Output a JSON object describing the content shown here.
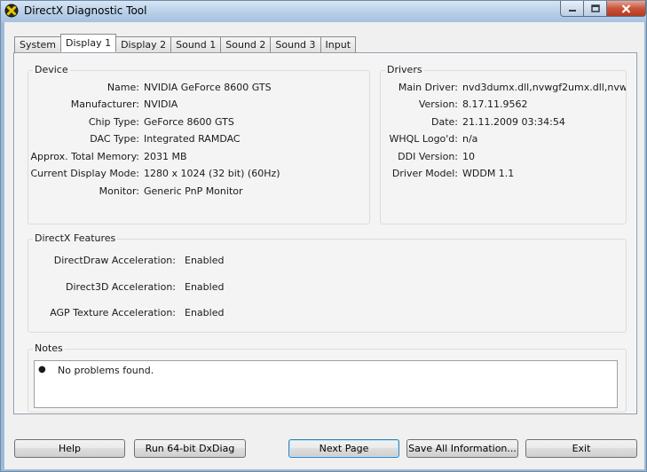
{
  "window": {
    "title": "DirectX Diagnostic Tool"
  },
  "tabs": [
    {
      "label": "System"
    },
    {
      "label": "Display 1"
    },
    {
      "label": "Display 2"
    },
    {
      "label": "Sound 1"
    },
    {
      "label": "Sound 2"
    },
    {
      "label": "Sound 3"
    },
    {
      "label": "Input"
    }
  ],
  "active_tab": "Display 1",
  "device": {
    "title": "Device",
    "rows": [
      {
        "label": "Name:",
        "value": "NVIDIA GeForce 8600 GTS"
      },
      {
        "label": "Manufacturer:",
        "value": "NVIDIA"
      },
      {
        "label": "Chip Type:",
        "value": "GeForce 8600 GTS"
      },
      {
        "label": "DAC Type:",
        "value": "Integrated RAMDAC"
      },
      {
        "label": "Approx. Total Memory:",
        "value": "2031 MB"
      },
      {
        "label": "Current Display Mode:",
        "value": "1280 x 1024 (32 bit) (60Hz)"
      },
      {
        "label": "Monitor:",
        "value": "Generic PnP Monitor"
      }
    ]
  },
  "drivers": {
    "title": "Drivers",
    "rows": [
      {
        "label": "Main Driver:",
        "value": "nvd3dumx.dll,nvwgf2umx.dll,nvwgf2"
      },
      {
        "label": "Version:",
        "value": "8.17.11.9562"
      },
      {
        "label": "Date:",
        "value": "21.11.2009 03:34:54"
      },
      {
        "label": "WHQL Logo'd:",
        "value": "n/a"
      },
      {
        "label": "DDI Version:",
        "value": "10"
      },
      {
        "label": "Driver Model:",
        "value": "WDDM 1.1"
      }
    ]
  },
  "features": {
    "title": "DirectX Features",
    "rows": [
      {
        "label": "DirectDraw Acceleration:",
        "value": "Enabled"
      },
      {
        "label": "Direct3D Acceleration:",
        "value": "Enabled"
      },
      {
        "label": "AGP Texture Acceleration:",
        "value": "Enabled"
      }
    ]
  },
  "notes": {
    "title": "Notes",
    "items": [
      "No problems found."
    ]
  },
  "buttons": {
    "help": "Help",
    "run64": "Run 64-bit DxDiag",
    "next_page": "Next Page",
    "save_all": "Save All Information...",
    "exit": "Exit"
  },
  "colors": {
    "title_bar": "#b7cfe8",
    "close_button": "#c8543b",
    "panel_background": "#f4f4f4"
  }
}
